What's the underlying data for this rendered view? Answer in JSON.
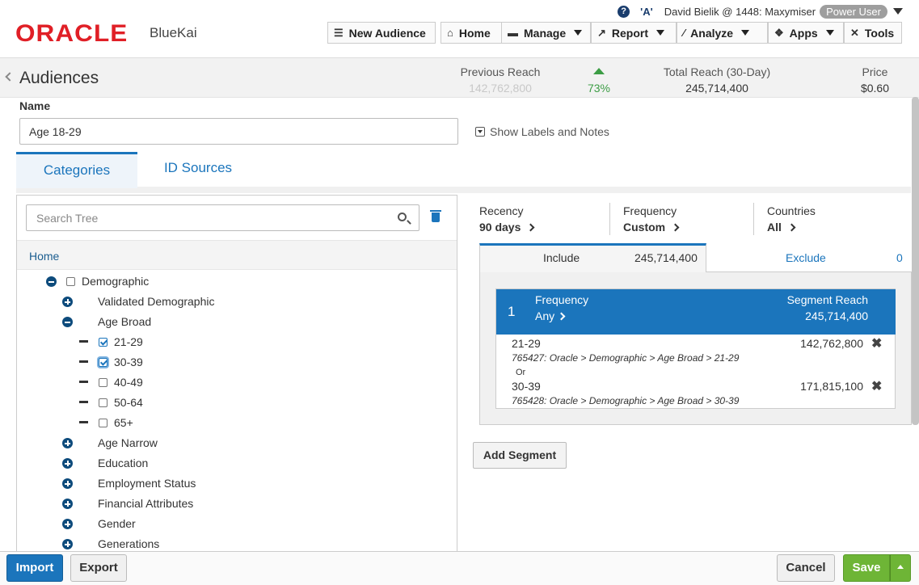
{
  "brand": {
    "oracle": "ORACLE",
    "product": "BlueKai"
  },
  "user": {
    "help": "?",
    "tower": "'A'",
    "name": "David Bielik @ 1448: Maxymiser",
    "role": "Power User"
  },
  "nav": {
    "new_audience": "New Audience",
    "home": "Home",
    "manage": "Manage",
    "report": "Report",
    "analyze": "Analyze",
    "apps": "Apps",
    "tools": "Tools"
  },
  "summary": {
    "title": "Audiences",
    "prev_reach_label": "Previous Reach",
    "prev_reach_value": "142,762,800",
    "change_pct": "73%",
    "total_reach_label": "Total Reach (30-Day)",
    "total_reach_value": "245,714,400",
    "price_label": "Price",
    "price_value": "$0.60",
    "colors": {
      "up": "#3c9d45",
      "accent": "#1b75bc"
    }
  },
  "name_section": {
    "label": "Name",
    "value": "Age 18-29",
    "show_labels": "Show Labels and Notes"
  },
  "tabs": {
    "categories": "Categories",
    "id_sources": "ID Sources"
  },
  "tree": {
    "search_placeholder": "Search Tree",
    "home": "Home",
    "demographic": "Demographic",
    "validated": "Validated Demographic",
    "age_broad": "Age Broad",
    "ages": [
      "21-29",
      "30-39",
      "40-49",
      "50-64",
      "65+"
    ],
    "age_checked": [
      true,
      true,
      false,
      false,
      false
    ],
    "age_narrow": "Age Narrow",
    "education": "Education",
    "employment": "Employment Status",
    "financial": "Financial Attributes",
    "gender": "Gender",
    "generations": "Generations"
  },
  "filters": {
    "recency_label": "Recency",
    "recency_value": "90 days",
    "frequency_label": "Frequency",
    "frequency_value": "Custom",
    "countries_label": "Countries",
    "countries_value": "All"
  },
  "include_tab": {
    "label": "Include",
    "value": "245,714,400"
  },
  "exclude_tab": {
    "label": "Exclude",
    "value": "0"
  },
  "segment": {
    "number": "1",
    "frequency_label": "Frequency",
    "frequency_value": "Any",
    "reach_label": "Segment Reach",
    "reach_value": "245,714,400",
    "items": [
      {
        "name": "21-29",
        "path": "765427: Oracle > Demographic > Age Broad > 21-29",
        "reach": "142,762,800"
      },
      {
        "name": "30-39",
        "path": "765428: Oracle > Demographic > Age Broad > 30-39",
        "reach": "171,815,100"
      }
    ],
    "or": "Or",
    "remove": "✖"
  },
  "add_segment": "Add Segment",
  "footer": {
    "import": "Import",
    "export": "Export",
    "cancel": "Cancel",
    "save": "Save"
  }
}
